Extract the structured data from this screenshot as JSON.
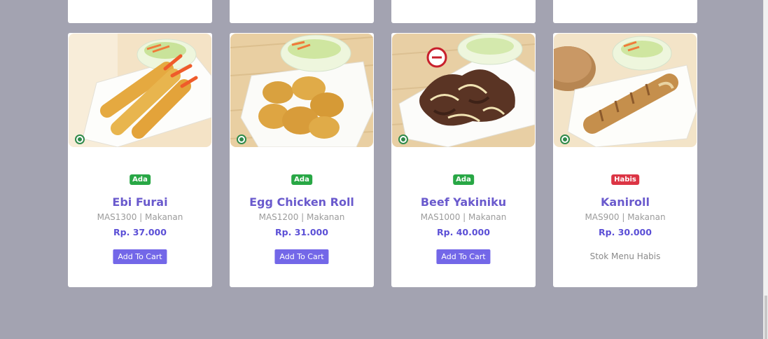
{
  "products": [
    {
      "name": "Ebi Furai",
      "code": "MAS1300 | Makanan",
      "price": "Rp. 37.000",
      "status": "Ada",
      "available": true,
      "action": "Add To Cart",
      "photo": "fried-shrimp-photo"
    },
    {
      "name": "Egg Chicken Roll",
      "code": "MAS1200 | Makanan",
      "price": "Rp. 31.000",
      "status": "Ada",
      "available": true,
      "action": "Add To Cart",
      "photo": "egg-chicken-roll-photo"
    },
    {
      "name": "Beef Yakiniku",
      "code": "MAS1000 | Makanan",
      "price": "Rp. 40.000",
      "status": "Ada",
      "available": true,
      "action": "Add To Cart",
      "photo": "beef-yakiniku-photo"
    },
    {
      "name": "Kaniroll",
      "code": "MAS900 | Makanan",
      "price": "Rp. 30.000",
      "status": "Habis",
      "available": false,
      "action": "Stok Menu Habis",
      "photo": "kaniroll-photo"
    }
  ],
  "colors": {
    "background": "#a3a3b1",
    "accent": "#7367e8",
    "available_badge": "#28a745",
    "soldout_badge": "#dc3545"
  }
}
